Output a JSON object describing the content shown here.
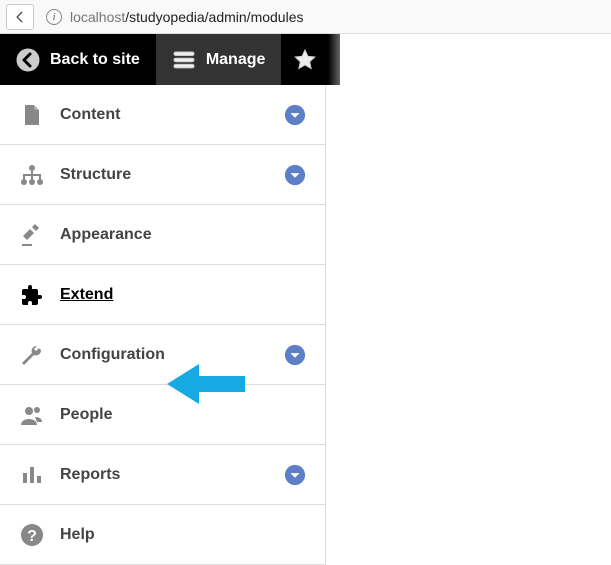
{
  "browser": {
    "url_host": "localhost",
    "url_path": "/studyopedia/admin/modules",
    "info_glyph": "i"
  },
  "toolbar": {
    "back_label": "Back to site",
    "manage_label": "Manage"
  },
  "colors": {
    "chevron": "#5c7fc5",
    "arrow": "#17a9e2"
  },
  "menu": {
    "items": [
      {
        "label": "Content",
        "has_chev": true
      },
      {
        "label": "Structure",
        "has_chev": true
      },
      {
        "label": "Appearance",
        "has_chev": false
      },
      {
        "label": "Extend",
        "has_chev": false
      },
      {
        "label": "Configuration",
        "has_chev": true
      },
      {
        "label": "People",
        "has_chev": false
      },
      {
        "label": "Reports",
        "has_chev": true
      },
      {
        "label": "Help",
        "has_chev": false
      }
    ]
  }
}
